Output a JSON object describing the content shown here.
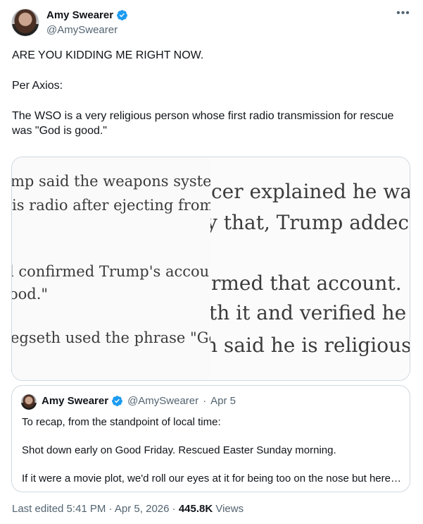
{
  "author": {
    "name": "Amy Swearer",
    "handle": "@AmySwearer"
  },
  "post": {
    "paragraphs": [
      "ARE YOU KIDDING ME RIGHT NOW.",
      "Per Axios:",
      "The WSO is a very religious person whose first radio transmission for rescue was \"God is good.\""
    ]
  },
  "media": {
    "left_lines": [
      "mp said the weapons syste",
      "is radio after ejecting from",
      "l confirmed Trump's accou",
      "ood.\"",
      "egseth used the phrase \"Go"
    ],
    "right_lines": [
      "cer explained he wa",
      "y that, Trump addec",
      "rmed that account.",
      "th it and verified he",
      "n said he is religious"
    ]
  },
  "quote": {
    "name": "Amy Swearer",
    "handle": "@AmySwearer",
    "date": "Apr 5",
    "paragraphs": [
      "To recap, from the standpoint of local time:",
      "Shot down early on Good Friday. Rescued Easter Sunday morning.",
      "If it were a movie plot, we'd roll our eyes at it for being too on the nose but here…"
    ]
  },
  "footer": {
    "edited": "Last edited 5:41 PM · Apr 5, 2026 ·",
    "views_count": "445.8K",
    "views_label": "Views"
  },
  "colors": {
    "verified": "#1d9bf0",
    "secondary_text": "#536471",
    "border": "#cfd9de"
  },
  "icons": {
    "verified": "verified-badge-icon",
    "more": "more-options-icon"
  }
}
